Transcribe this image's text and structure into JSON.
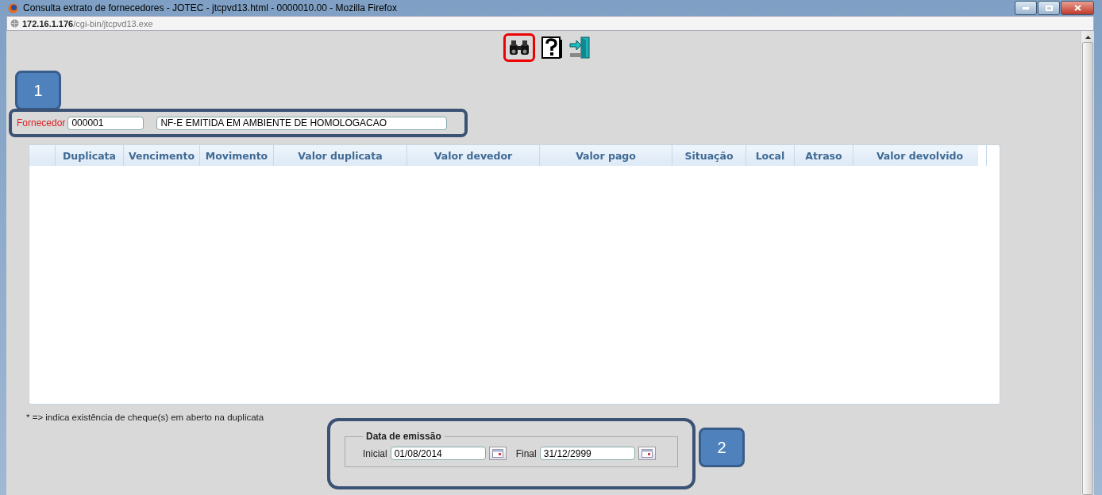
{
  "window": {
    "title": "Consulta extrato de fornecedores - JOTEC - jtcpvd13.html - 0000010.00 - Mozilla Firefox"
  },
  "address_bar": {
    "host": "172.16.1.176",
    "path": "/cgi-bin/jtcpvd13.exe"
  },
  "toolbar": [
    {
      "kind": "search",
      "highlighted": true
    },
    {
      "kind": "help",
      "highlighted": false
    },
    {
      "kind": "exit",
      "highlighted": false
    }
  ],
  "callouts": [
    "1",
    "2"
  ],
  "supplier": {
    "label": "Fornecedor",
    "code": "000001",
    "name": "NF-E EMITIDA EM AMBIENTE DE HOMOLOGACAO"
  },
  "table": {
    "columns": [
      "",
      "Duplicata",
      "Vencimento",
      "Movimento",
      "Valor duplicata",
      "Valor devedor",
      "Valor pago",
      "Situação",
      "Local",
      "Atraso",
      "Valor devolvido"
    ]
  },
  "note": "* => indica existência de cheque(s) em aberto na duplicata",
  "date_filter": {
    "legend": "Data de emissão",
    "start_label": "Inicial",
    "start": "01/08/2014",
    "end_label": "Final",
    "end": "31/12/2999"
  }
}
